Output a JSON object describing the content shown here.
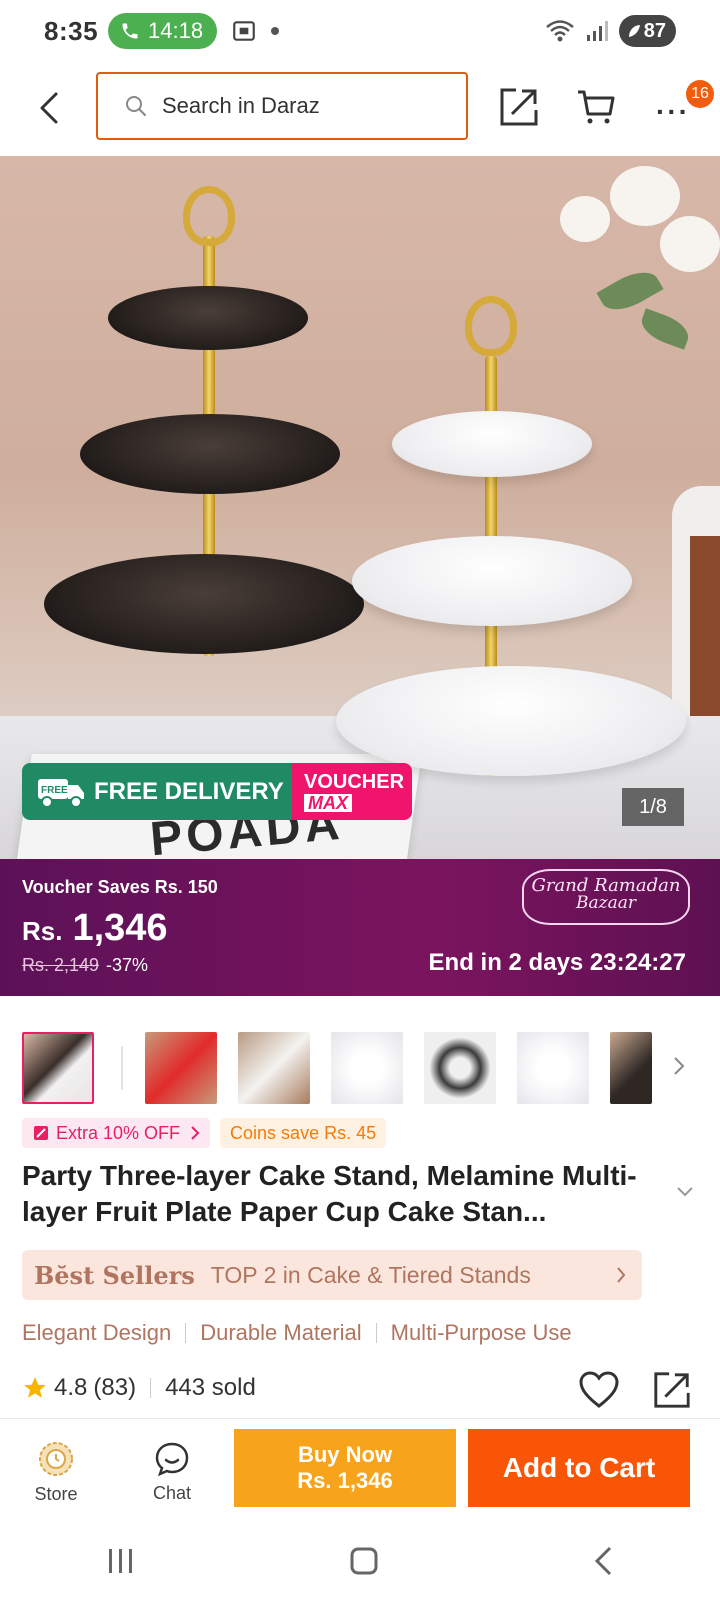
{
  "status_bar": {
    "time": "8:35",
    "call_duration": "14:18",
    "battery_level": "87"
  },
  "header": {
    "search_placeholder": "Search in Daraz",
    "notification_count": "16",
    "more_label": "···"
  },
  "hero": {
    "book_label": "POADA",
    "free_delivery_label": "FREE DELIVERY",
    "free_tag": "FREE",
    "voucher_top": "VOUCHER",
    "voucher_bottom": "MAX",
    "image_counter": "1/8"
  },
  "price_banner": {
    "voucher_saves": "Voucher Saves Rs. 150",
    "currency": "Rs.",
    "price": "1,346",
    "original_price": "Rs. 2,149",
    "discount": "-37%",
    "campaign_line1": "Grand Ramadan",
    "campaign_line2": "Bazaar",
    "end_timer": "End in 2 days 23:24:27"
  },
  "promos": {
    "extra_off": "Extra 10% OFF",
    "coins_save": "Coins save Rs. 45"
  },
  "product": {
    "title": "Party Three-layer Cake Stand, Melamine Multi-layer Fruit Plate Paper Cup Cake Stan..."
  },
  "best_sellers": {
    "brand": "Bĕst Sellers",
    "text": "TOP 2 in Cake & Tiered Stands"
  },
  "tags": [
    "Elegant Design",
    "Durable Material",
    "Multi-Purpose Use"
  ],
  "rating": {
    "value": "4.8",
    "count": "(83)",
    "sold": "443 sold"
  },
  "actions": {
    "store_label": "Store",
    "chat_label": "Chat",
    "buy_now_label": "Buy Now",
    "buy_now_price": "Rs. 1,346",
    "add_to_cart_label": "Add to Cart"
  },
  "colors": {
    "brand_orange": "#f85606",
    "buy_now": "#f7a41c",
    "price_banner": "#6b1259",
    "voucher_pink": "#f0146d",
    "delivery_green": "#1f8a63"
  }
}
